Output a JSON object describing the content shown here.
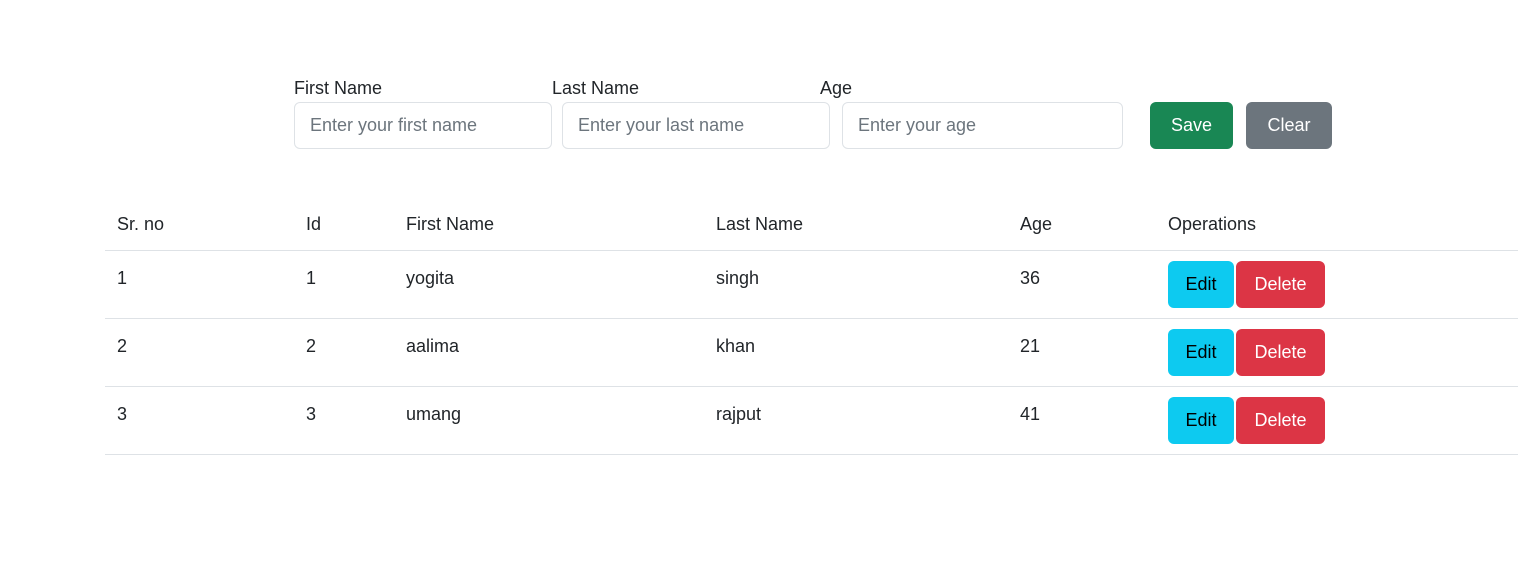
{
  "form": {
    "first_name_label": "First Name",
    "first_name_placeholder": "Enter your first name",
    "first_name_value": "",
    "last_name_label": "Last Name",
    "last_name_placeholder": "Enter your last name",
    "last_name_value": "",
    "age_label": "Age",
    "age_placeholder": "Enter your age",
    "age_value": "",
    "save_label": "Save",
    "clear_label": "Clear"
  },
  "table": {
    "headers": [
      "Sr. no",
      "Id",
      "First Name",
      "Last Name",
      "Age",
      "Operations"
    ],
    "rows": [
      {
        "sr": "1",
        "id": "1",
        "first_name": "yogita",
        "last_name": "singh",
        "age": "36"
      },
      {
        "sr": "2",
        "id": "2",
        "first_name": "aalima",
        "last_name": "khan",
        "age": "21"
      },
      {
        "sr": "3",
        "id": "3",
        "first_name": "umang",
        "last_name": "rajput",
        "age": "41"
      }
    ],
    "edit_label": "Edit",
    "delete_label": "Delete"
  },
  "colors": {
    "save": "#198754",
    "clear": "#6c757d",
    "edit": "#0dcaf0",
    "delete": "#dc3545"
  }
}
